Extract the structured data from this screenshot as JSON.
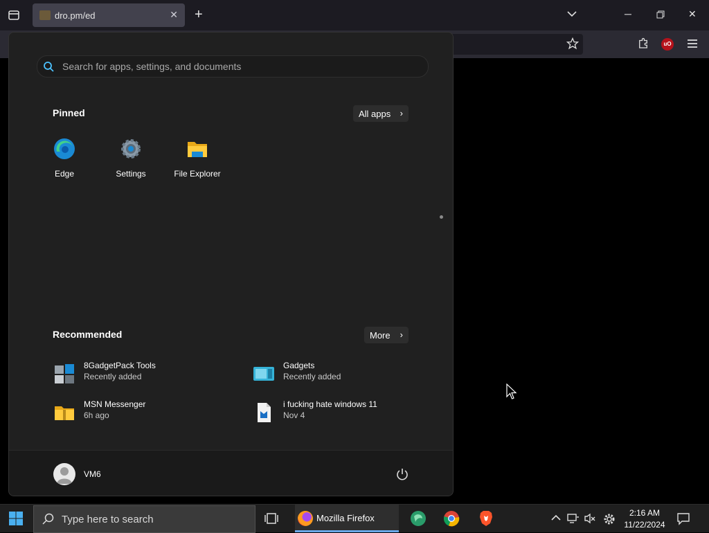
{
  "browser": {
    "tab_title": "dro.pm/ed",
    "new_tab_icon": "plus-icon"
  },
  "start_menu": {
    "search_placeholder": "Search for apps, settings, and documents",
    "pinned_heading": "Pinned",
    "all_apps_label": "All apps",
    "pinned": [
      {
        "label": "Edge",
        "icon": "edge-icon"
      },
      {
        "label": "Settings",
        "icon": "settings-gear-icon"
      },
      {
        "label": "File Explorer",
        "icon": "folder-icon"
      }
    ],
    "recommended_heading": "Recommended",
    "more_label": "More",
    "recommended": [
      {
        "name": "8GadgetPack Tools",
        "sub": "Recently added",
        "icon": "gadgetpack-icon"
      },
      {
        "name": "Gadgets",
        "sub": "Recently added",
        "icon": "gadgets-icon"
      },
      {
        "name": "MSN Messenger",
        "sub": "6h ago",
        "icon": "zip-folder-icon"
      },
      {
        "name": "i fucking hate windows 11",
        "sub": "Nov 4",
        "icon": "document-icon"
      }
    ],
    "user_name": "VM6"
  },
  "taskbar": {
    "search_placeholder": "Type here to search",
    "firefox_label": "Mozilla Firefox",
    "time": "2:16 AM",
    "date": "11/22/2024"
  },
  "colors": {
    "accent_blue": "#0078d4",
    "start_bg": "#202020",
    "taskbar_bg": "#1f1f1f"
  }
}
